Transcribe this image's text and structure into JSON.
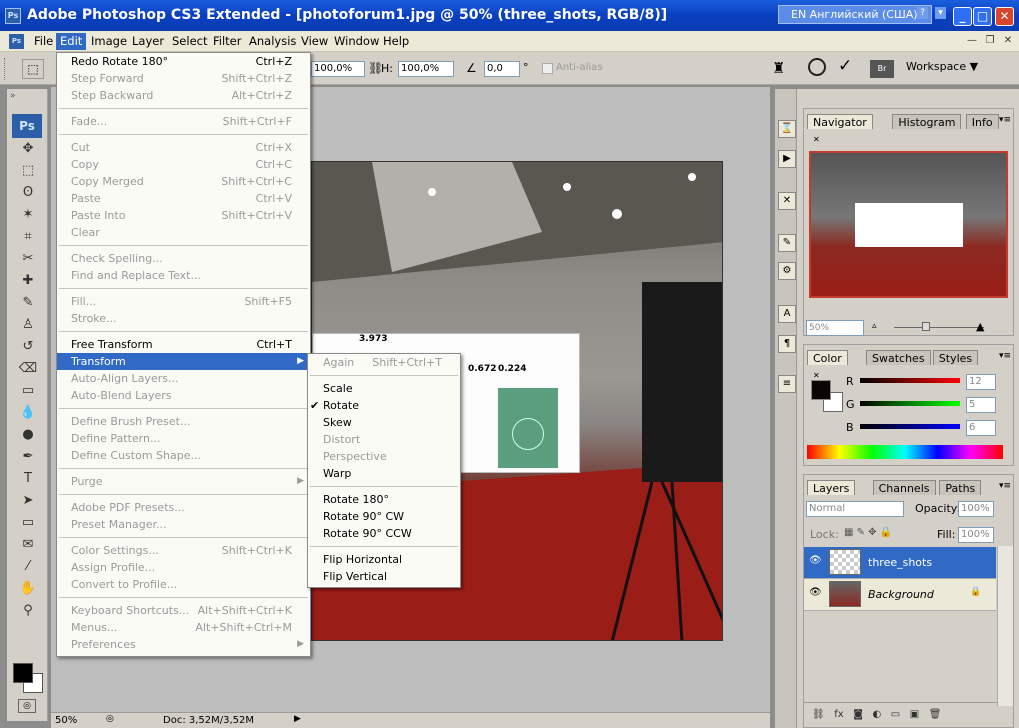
{
  "window": {
    "title": "Adobe Photoshop CS3 Extended - [photoforum1.jpg @ 50% (three_shots, RGB/8)]",
    "app_badge": "Ps",
    "language": "EN Английский (США)",
    "btn_min": "_",
    "btn_max": "□",
    "btn_close": "✕"
  },
  "menubar": [
    "File",
    "Edit",
    "Image",
    "Layer",
    "Select",
    "Filter",
    "Analysis",
    "View",
    "Window",
    "Help"
  ],
  "options": {
    "w_value": "100,0%",
    "h_label": "H:",
    "h_value": "100,0%",
    "angle_value": "0,0",
    "angle_unit": "°",
    "antialias": "Anti-alias",
    "workspace": "Workspace"
  },
  "edit_menu": [
    {
      "label": "Redo Rotate 180°",
      "shortcut": "Ctrl+Z",
      "disabled": false
    },
    {
      "label": "Step Forward",
      "shortcut": "Shift+Ctrl+Z",
      "disabled": true
    },
    {
      "label": "Step Backward",
      "shortcut": "Alt+Ctrl+Z",
      "disabled": true
    },
    {
      "sep": true
    },
    {
      "label": "Fade...",
      "shortcut": "Shift+Ctrl+F",
      "disabled": true
    },
    {
      "sep": true
    },
    {
      "label": "Cut",
      "shortcut": "Ctrl+X",
      "disabled": true
    },
    {
      "label": "Copy",
      "shortcut": "Ctrl+C",
      "disabled": true
    },
    {
      "label": "Copy Merged",
      "shortcut": "Shift+Ctrl+C",
      "disabled": true
    },
    {
      "label": "Paste",
      "shortcut": "Ctrl+V",
      "disabled": true
    },
    {
      "label": "Paste Into",
      "shortcut": "Shift+Ctrl+V",
      "disabled": true
    },
    {
      "label": "Clear",
      "shortcut": "",
      "disabled": true
    },
    {
      "sep": true
    },
    {
      "label": "Check Spelling...",
      "shortcut": "",
      "disabled": true
    },
    {
      "label": "Find and Replace Text...",
      "shortcut": "",
      "disabled": true
    },
    {
      "sep": true
    },
    {
      "label": "Fill...",
      "shortcut": "Shift+F5",
      "disabled": true
    },
    {
      "label": "Stroke...",
      "shortcut": "",
      "disabled": true
    },
    {
      "sep": true
    },
    {
      "label": "Free Transform",
      "shortcut": "Ctrl+T",
      "disabled": false
    },
    {
      "label": "Transform",
      "shortcut": "",
      "disabled": false,
      "highlight": true,
      "submenu": true
    },
    {
      "label": "Auto-Align Layers...",
      "shortcut": "",
      "disabled": true
    },
    {
      "label": "Auto-Blend Layers",
      "shortcut": "",
      "disabled": true
    },
    {
      "sep": true
    },
    {
      "label": "Define Brush Preset...",
      "shortcut": "",
      "disabled": true
    },
    {
      "label": "Define Pattern...",
      "shortcut": "",
      "disabled": true
    },
    {
      "label": "Define Custom Shape...",
      "shortcut": "",
      "disabled": true
    },
    {
      "sep": true
    },
    {
      "label": "Purge",
      "shortcut": "",
      "disabled": true,
      "submenu": true
    },
    {
      "sep": true
    },
    {
      "label": "Adobe PDF Presets...",
      "shortcut": "",
      "disabled": true
    },
    {
      "label": "Preset Manager...",
      "shortcut": "",
      "disabled": true
    },
    {
      "sep": true
    },
    {
      "label": "Color Settings...",
      "shortcut": "Shift+Ctrl+K",
      "disabled": true
    },
    {
      "label": "Assign Profile...",
      "shortcut": "",
      "disabled": true
    },
    {
      "label": "Convert to Profile...",
      "shortcut": "",
      "disabled": true
    },
    {
      "sep": true
    },
    {
      "label": "Keyboard Shortcuts...",
      "shortcut": "Alt+Shift+Ctrl+K",
      "disabled": true
    },
    {
      "label": "Menus...",
      "shortcut": "Alt+Shift+Ctrl+M",
      "disabled": true
    },
    {
      "label": "Preferences",
      "shortcut": "",
      "disabled": true,
      "submenu": true
    }
  ],
  "transform_menu": [
    {
      "label": "Again",
      "shortcut": "Shift+Ctrl+T",
      "disabled": true
    },
    {
      "sep": true
    },
    {
      "label": "Scale",
      "shortcut": "",
      "disabled": false
    },
    {
      "label": "Rotate",
      "shortcut": "",
      "disabled": false,
      "checked": true
    },
    {
      "label": "Skew",
      "shortcut": "",
      "disabled": false
    },
    {
      "label": "Distort",
      "shortcut": "",
      "disabled": true
    },
    {
      "label": "Perspective",
      "shortcut": "",
      "disabled": true
    },
    {
      "label": "Warp",
      "shortcut": "",
      "disabled": false
    },
    {
      "sep": true
    },
    {
      "label": "Rotate 180°",
      "shortcut": "",
      "disabled": false
    },
    {
      "label": "Rotate 90° CW",
      "shortcut": "",
      "disabled": false
    },
    {
      "label": "Rotate 90° CCW",
      "shortcut": "",
      "disabled": false
    },
    {
      "sep": true
    },
    {
      "label": "Flip Horizontal",
      "shortcut": "",
      "disabled": false
    },
    {
      "label": "Flip Vertical",
      "shortcut": "",
      "disabled": false
    }
  ],
  "canvas_labels": {
    "a": "3.973",
    "b": "0.672",
    "c": "0.224"
  },
  "status": {
    "zoom": "50%",
    "doc": "Doc: 3,52M/3,52M"
  },
  "navigator": {
    "tabs": [
      "Navigator",
      "Histogram",
      "Info"
    ],
    "zoom": "50%"
  },
  "color": {
    "tabs": [
      "Color",
      "Swatches",
      "Styles"
    ],
    "R": "12",
    "G": "5",
    "B": "6",
    "r_label": "R",
    "g_label": "G",
    "b_label": "B"
  },
  "layers": {
    "tabs": [
      "Layers",
      "Channels",
      "Paths"
    ],
    "blend": "Normal",
    "opacity_label": "Opacity:",
    "opacity": "100%",
    "lock_label": "Lock:",
    "fill_label": "Fill:",
    "fill": "100%",
    "items": [
      {
        "name": "three_shots",
        "selected": true
      },
      {
        "name": "Background",
        "selected": false
      }
    ]
  }
}
